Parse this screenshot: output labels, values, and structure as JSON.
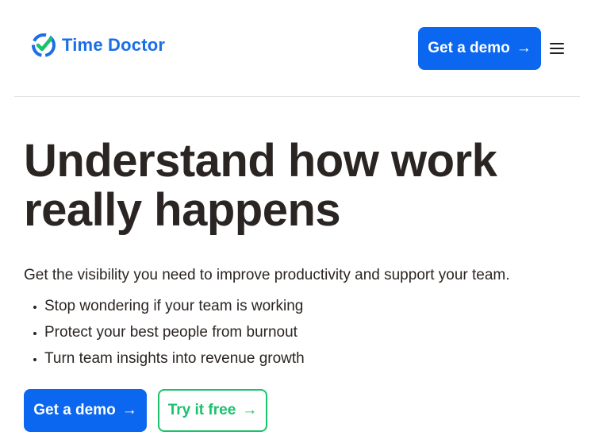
{
  "header": {
    "logo_text": "Time Doctor",
    "demo_button": "Get a demo",
    "demo_arrow": "→",
    "menu_icon": "hamburger-menu-icon"
  },
  "hero": {
    "headline_line1": "Understand how work",
    "headline_line2": "really happens",
    "subtitle": "Get the visibility you need to improve productivity and support your team.",
    "bullets": [
      "Stop wondering if your team is working",
      "Protect your best people from burnout",
      "Turn team insights into revenue growth"
    ],
    "primary_cta": "Get a demo",
    "primary_arrow": "→",
    "secondary_cta": "Try it free",
    "secondary_arrow": "→"
  },
  "colors": {
    "brand_blue": "#0b66f0",
    "logo_blue": "#1a6ee8",
    "accent_green": "#19c26b",
    "text_dark": "#2a2522"
  }
}
